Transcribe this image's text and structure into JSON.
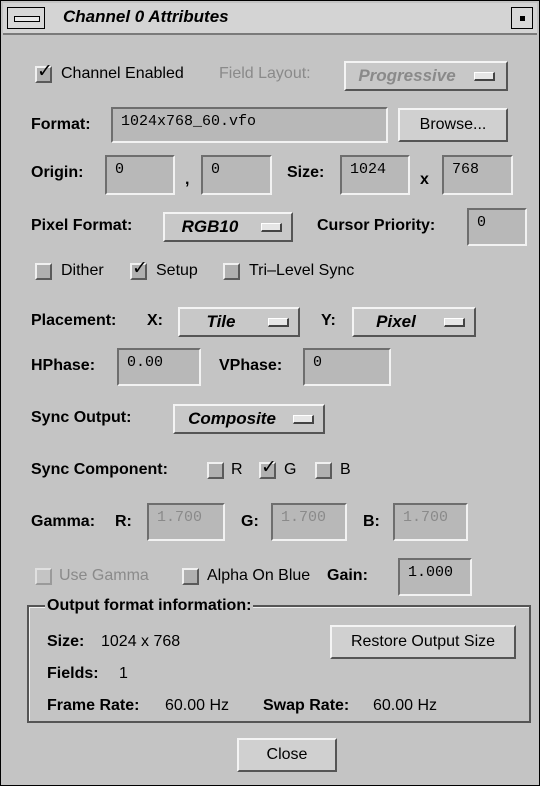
{
  "window": {
    "title": "Channel 0 Attributes"
  },
  "channel_enabled": {
    "label": "Channel Enabled",
    "checked": true
  },
  "field_layout": {
    "label": "Field Layout:",
    "value": "Progressive"
  },
  "format": {
    "label": "Format:",
    "value": "1024x768_60.vfo",
    "browse": "Browse..."
  },
  "origin": {
    "label": "Origin:",
    "x": "0",
    "sep": ",",
    "y": "0"
  },
  "size": {
    "label": "Size:",
    "w": "1024",
    "x": "x",
    "h": "768"
  },
  "pixel_format": {
    "label": "Pixel Format:",
    "value": "RGB10"
  },
  "cursor_priority": {
    "label": "Cursor Priority:",
    "value": "0"
  },
  "options": {
    "dither": "Dither",
    "setup": "Setup",
    "trilevel": "Tri–Level Sync",
    "dither_checked": false,
    "setup_checked": true,
    "trilevel_checked": false
  },
  "placement": {
    "label": "Placement:",
    "x_label": "X:",
    "x_value": "Tile",
    "y_label": "Y:",
    "y_value": "Pixel"
  },
  "hphase": {
    "label": "HPhase:",
    "value": "0.00"
  },
  "vphase": {
    "label": "VPhase:",
    "value": "0"
  },
  "sync_output": {
    "label": "Sync Output:",
    "value": "Composite"
  },
  "sync_component": {
    "label": "Sync Component:",
    "r": "R",
    "g": "G",
    "b": "B",
    "r_checked": false,
    "g_checked": true,
    "b_checked": false
  },
  "gamma": {
    "label": "Gamma:",
    "r_label": "R:",
    "r": "1.700",
    "g_label": "G:",
    "g": "1.700",
    "b_label": "B:",
    "b": "1.700"
  },
  "use_gamma": {
    "label": "Use Gamma",
    "checked": false
  },
  "alpha_on_blue": {
    "label": "Alpha On Blue",
    "checked": false
  },
  "gain": {
    "label": "Gain:",
    "value": "1.000"
  },
  "output_info": {
    "title": "Output format information:",
    "size_label": "Size:",
    "size_value": "1024 x 768",
    "restore": "Restore Output Size",
    "fields_label": "Fields:",
    "fields_value": "1",
    "frame_rate_label": "Frame Rate:",
    "frame_rate_value": "60.00 Hz",
    "swap_rate_label": "Swap Rate:",
    "swap_rate_value": "60.00 Hz"
  },
  "close": "Close",
  "icons": {
    "menu": "window-menu-icon",
    "corner": "window-minimize-icon"
  }
}
